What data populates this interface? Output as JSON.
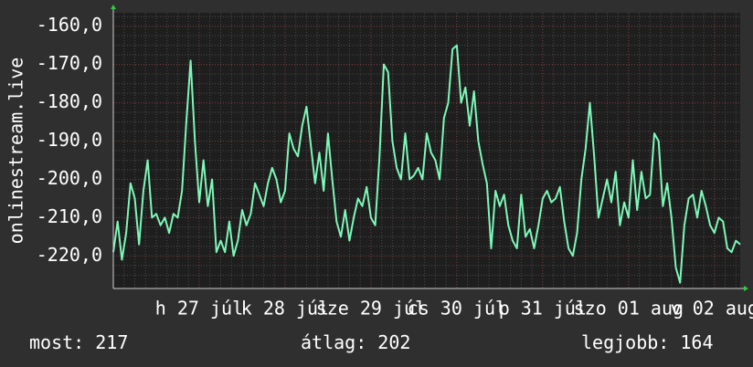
{
  "chart_data": {
    "type": "line",
    "ylabel": "onlinestream.live",
    "ylim": [
      -228.5,
      -156.5
    ],
    "y_ticks": [
      "-160,0",
      "-170,0",
      "-180,0",
      "-190,0",
      "-200,0",
      "-210,0",
      "-220,0"
    ],
    "y_tick_values": [
      -160,
      -170,
      -180,
      -190,
      -200,
      -210,
      -220
    ],
    "x_tick_labels": [
      "h 27 júl",
      "k 28 júl",
      "sze 29 júl",
      "cs 30 júl",
      "p 31 júl",
      "szo 01 aug",
      "v 02 aug"
    ],
    "x_day_ticks": [
      1.0,
      2.0,
      3.0,
      4.0,
      5.0,
      6.0,
      7.0
    ],
    "xlim": [
      0.0,
      7.3
    ],
    "grid": true,
    "line_color": "#7ef7b8",
    "series": [
      {
        "x": [
          0.0,
          0.05,
          0.1,
          0.15,
          0.2,
          0.25,
          0.3,
          0.35,
          0.4,
          0.45,
          0.5,
          0.55,
          0.6,
          0.65,
          0.7,
          0.75,
          0.8,
          0.85,
          0.9,
          0.95,
          1.0,
          1.05,
          1.1,
          1.15,
          1.2,
          1.25,
          1.3,
          1.35,
          1.4,
          1.45,
          1.5,
          1.55,
          1.6,
          1.65,
          1.7,
          1.75,
          1.8,
          1.85,
          1.9,
          1.95,
          2.0,
          2.05,
          2.1,
          2.15,
          2.2,
          2.25,
          2.3,
          2.35,
          2.4,
          2.45,
          2.5,
          2.55,
          2.6,
          2.65,
          2.7,
          2.75,
          2.8,
          2.85,
          2.9,
          2.95,
          3.0,
          3.05,
          3.1,
          3.15,
          3.2,
          3.25,
          3.3,
          3.35,
          3.4,
          3.45,
          3.5,
          3.55,
          3.6,
          3.65,
          3.7,
          3.75,
          3.8,
          3.85,
          3.9,
          3.95,
          4.0,
          4.05,
          4.1,
          4.15,
          4.2,
          4.25,
          4.3,
          4.35,
          4.4,
          4.45,
          4.5,
          4.55,
          4.6,
          4.65,
          4.7,
          4.75,
          4.8,
          4.85,
          4.9,
          4.95,
          5.0,
          5.05,
          5.1,
          5.15,
          5.2,
          5.25,
          5.3,
          5.35,
          5.4,
          5.45,
          5.5,
          5.55,
          5.6,
          5.65,
          5.7,
          5.75,
          5.8,
          5.85,
          5.9,
          5.95,
          6.0,
          6.05,
          6.1,
          6.15,
          6.2,
          6.25,
          6.3,
          6.35,
          6.4,
          6.45,
          6.5,
          6.55,
          6.6,
          6.65,
          6.7,
          6.75,
          6.8,
          6.85,
          6.9,
          6.95,
          7.0,
          7.05,
          7.1,
          7.15,
          7.2,
          7.25,
          7.3
        ],
        "y": [
          -219,
          -211,
          -221,
          -214,
          -201,
          -205,
          -217,
          -203,
          -195,
          -210,
          -209,
          -212,
          -210,
          -214,
          -209,
          -210,
          -203,
          -185,
          -169,
          -190,
          -206,
          -195,
          -207,
          -200,
          -219,
          -216,
          -219,
          -211,
          -220,
          -216,
          -208,
          -212,
          -209,
          -201,
          -204,
          -207,
          -201,
          -197,
          -200,
          -206,
          -203,
          -188,
          -192,
          -194,
          -186,
          -181,
          -191,
          -201,
          -193,
          -203,
          -188,
          -200,
          -211,
          -215,
          -208,
          -216,
          -210,
          -205,
          -207,
          -202,
          -210,
          -212,
          -194,
          -170,
          -172,
          -190,
          -197,
          -200,
          -188,
          -200,
          -199,
          -197,
          -200,
          -188,
          -193,
          -195,
          -200,
          -184,
          -180,
          -166,
          -165,
          -180,
          -176,
          -186,
          -177,
          -190,
          -196,
          -201,
          -218,
          -203,
          -207,
          -204,
          -212,
          -216,
          -218,
          -204,
          -215,
          -213,
          -218,
          -212,
          -205,
          -203,
          -206,
          -205,
          -202,
          -211,
          -218,
          -220,
          -214,
          -200,
          -192,
          -180,
          -194,
          -210,
          -205,
          -200,
          -206,
          -198,
          -212,
          -206,
          -210,
          -195,
          -208,
          -198,
          -205,
          -204,
          -188,
          -190,
          -207,
          -201,
          -210,
          -223,
          -227,
          -212,
          -205,
          -204,
          -210,
          -203,
          -207,
          -212,
          -214,
          -210,
          -211,
          -218,
          -219,
          -216,
          -217
        ]
      }
    ]
  },
  "stats": {
    "current": "most: 217",
    "average": "átlag: 202",
    "best": "legjobb: 164"
  }
}
